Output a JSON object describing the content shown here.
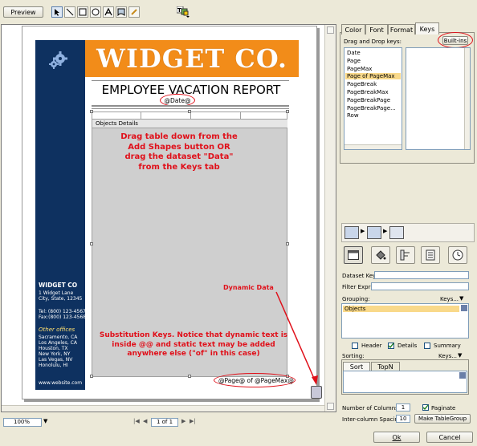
{
  "toolbar": {
    "preview_label": "Preview",
    "tools": [
      "pointer-tool-icon",
      "line-tool-icon",
      "rectangle-tool-icon",
      "ellipse-tool-icon",
      "text-tool-icon",
      "shape-tool-icon",
      "pen-tool-icon"
    ]
  },
  "report": {
    "logo_text": "WIDGET CO.",
    "title": "EMPLOYEE VACATION REPORT",
    "date_key": "@Date@",
    "table_header": "Objects Details",
    "page_keys": "@Page@ of @PageMax@",
    "sidebar": {
      "company": "WIDGET CO",
      "address1": "1 Widget Lane",
      "address2": "City, State, 12345",
      "tel": "Tel: (800) 123-4567",
      "fax": "Fax:(800) 123-4568",
      "other_offices": "Other offices",
      "offices": [
        "Sacramento, CA",
        "Los Angeles, CA",
        "Houston, TX",
        "New York, NY",
        "Las Vegas, NV",
        "Honolulu, HI"
      ],
      "website": "www.website.com"
    }
  },
  "annotations": {
    "drag_table": "Drag table down from the Add Shapes button OR drag the dataset \"Data\" from the Keys tab",
    "dynamic_data": "Dynamic Data",
    "substitution": "Substitution Keys. Notice that dynamic text is inside @@ and static text may be added anywhere else (\"of\" in this case)"
  },
  "status_bar": {
    "zoom": "100%",
    "page_indicator": "1 of 1"
  },
  "right_panel": {
    "tabs": [
      "Color",
      "Font",
      "Format",
      "Keys"
    ],
    "active_tab": "Keys",
    "drag_drop_label": "Drag and Drop keys:",
    "builtins_label": "Built-ins",
    "keys": [
      "Date",
      "Page",
      "PageMax",
      "Page of PageMax",
      "PageBreak",
      "PageBreakMax",
      "PageBreakPage",
      "PageBreakPage...",
      "Row"
    ],
    "selected_key": "Page of PageMax",
    "dataset_key_label": "Dataset Key:",
    "filter_expr_label": "Filter Expr:",
    "grouping_label": "Grouping:",
    "grouping_keys_label": "Keys...",
    "grouping_items": [
      "Objects"
    ],
    "header_label": "Header",
    "details_label": "Details",
    "summary_label": "Summary",
    "sorting_label": "Sorting:",
    "sorting_keys_label": "Keys...",
    "sort_tab": "Sort",
    "topn_tab": "TopN",
    "num_columns_label": "Number of Columns:",
    "num_columns_value": "1",
    "paginate_label": "Paginate",
    "spacing_label": "Inter-column Spacing:",
    "spacing_value": "10",
    "make_tablegroup_label": "Make TableGroup"
  },
  "dialog": {
    "ok_label": "Ok",
    "cancel_label": "Cancel"
  },
  "colors": {
    "accent_orange": "#f28c19",
    "navy": "#0e3160",
    "annotation_red": "#e0101a",
    "selection_yellow": "#f9d98a"
  }
}
